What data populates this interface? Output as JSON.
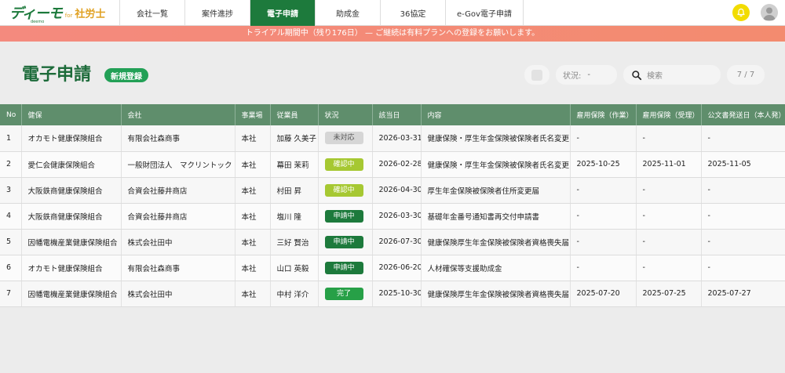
{
  "logo": {
    "main": "ディーモ",
    "for": "for",
    "sub": "社労士",
    "tiny": "deemo"
  },
  "nav": [
    {
      "label": "会社一覧",
      "active": false
    },
    {
      "label": "案件進捗",
      "active": false
    },
    {
      "label": "電子申請",
      "active": true
    },
    {
      "label": "助成金",
      "active": false
    },
    {
      "label": "36協定",
      "active": false
    },
    {
      "label": "e-Gov電子申請",
      "active": false
    }
  ],
  "banner": "トライアル期間中（残り176日） — ご継続は有料プランへの登録をお願いします。",
  "header": {
    "title": "電子申請",
    "new_label": "新規登録",
    "status_label": "状況:",
    "status_value": "-",
    "search_placeholder": "検索",
    "count": "7 / 7"
  },
  "table": {
    "columns": [
      "No",
      "健保",
      "会社",
      "事業場",
      "従業員",
      "状況",
      "該当日",
      "内容",
      "雇用保険（作業）",
      "雇用保険（受理）",
      "公文書発送日（本人発）"
    ],
    "rows": [
      {
        "no": "1",
        "kenpo": "オカモト健康保険組合",
        "company": "有限会社森商事",
        "site": "本社",
        "employee": "加藤 久美子",
        "status": "未対応",
        "status_type": "pending",
        "date": "2026-03-31",
        "content": "健康保険・厚生年金保険被保険者氏名変更",
        "ei_work": "-",
        "ei_accept": "-",
        "sent": "-"
      },
      {
        "no": "2",
        "kenpo": "愛仁会健康保険組合",
        "company": "一般財団法人　マクリントック",
        "site": "本社",
        "employee": "幕田 茉莉",
        "status": "確認中",
        "status_type": "confirm",
        "date": "2026-02-28",
        "content": "健康保険・厚生年金保険被保険者氏名変更",
        "ei_work": "2025-10-25",
        "ei_accept": "2025-11-01",
        "sent": "2025-11-05"
      },
      {
        "no": "3",
        "kenpo": "大阪鉄商健康保険組合",
        "company": "合資会社藤井商店",
        "site": "本社",
        "employee": "村田 昇",
        "status": "確認中",
        "status_type": "confirm",
        "date": "2026-04-30",
        "content": "厚生年金保険被保険者住所変更届",
        "ei_work": "-",
        "ei_accept": "-",
        "sent": "-"
      },
      {
        "no": "4",
        "kenpo": "大阪鉄商健康保険組合",
        "company": "合資会社藤井商店",
        "site": "本社",
        "employee": "塩川 隆",
        "status": "申請中",
        "status_type": "applying",
        "date": "2026-03-30",
        "content": "基礎年金番号通知書再交付申請書",
        "ei_work": "-",
        "ei_accept": "-",
        "sent": "-"
      },
      {
        "no": "5",
        "kenpo": "因幡電機産業健康保険組合",
        "company": "株式会社田中",
        "site": "本社",
        "employee": "三好 賢治",
        "status": "申請中",
        "status_type": "applying",
        "date": "2026-07-30",
        "content": "健康保険厚生年金保険被保険者資格喪失届",
        "ei_work": "-",
        "ei_accept": "-",
        "sent": "-"
      },
      {
        "no": "6",
        "kenpo": "オカモト健康保険組合",
        "company": "有限会社森商事",
        "site": "本社",
        "employee": "山口 英毅",
        "status": "申請中",
        "status_type": "applying",
        "date": "2026-06-20",
        "content": "人材確保等支援助成金",
        "ei_work": "-",
        "ei_accept": "-",
        "sent": "-"
      },
      {
        "no": "7",
        "kenpo": "因幡電機産業健康保険組合",
        "company": "株式会社田中",
        "site": "本社",
        "employee": "中村 洋介",
        "status": "完了",
        "status_type": "done",
        "date": "2025-10-30",
        "content": "健康保険厚生年金保険被保険者資格喪失届",
        "ei_work": "2025-07-20",
        "ei_accept": "2025-07-25",
        "sent": "2025-07-27"
      }
    ]
  }
}
